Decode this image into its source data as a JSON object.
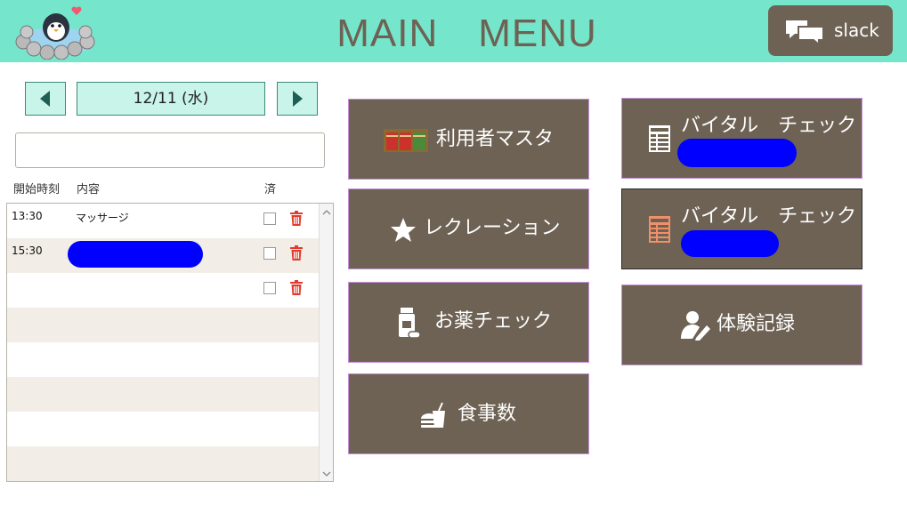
{
  "header": {
    "title": "MAIN　MENU",
    "slack_label": "slack"
  },
  "schedule": {
    "date": "12/11 (水)",
    "search_value": "",
    "columns": {
      "start_time": "開始時刻",
      "content": "内容",
      "done": "済"
    },
    "rows": [
      {
        "time": "13:30",
        "content": "マッサージ",
        "done": false,
        "delete": true
      },
      {
        "time": "15:30",
        "content": "",
        "done": false,
        "delete": true,
        "redacted": true
      },
      {
        "time": "",
        "content": "",
        "done": false,
        "delete": true
      },
      {
        "time": "",
        "content": ""
      },
      {
        "time": "",
        "content": ""
      },
      {
        "time": "",
        "content": ""
      },
      {
        "time": "",
        "content": ""
      },
      {
        "time": "",
        "content": ""
      }
    ]
  },
  "menu": {
    "user_master": "利用者マスタ",
    "recreation": "レクレーション",
    "medicine_check": "お薬チェック",
    "meal_count": "食事数",
    "vital_check_1": "バイタル　チェック",
    "vital_check_2": "バイタル　チェック",
    "experience_record": "体験記録"
  },
  "colors": {
    "header_bg": "#75e6cb",
    "button_bg": "#6d6254",
    "date_bg": "#c8f4ea",
    "trash_red": "#e23b2e",
    "redaction": "#0000ff"
  }
}
